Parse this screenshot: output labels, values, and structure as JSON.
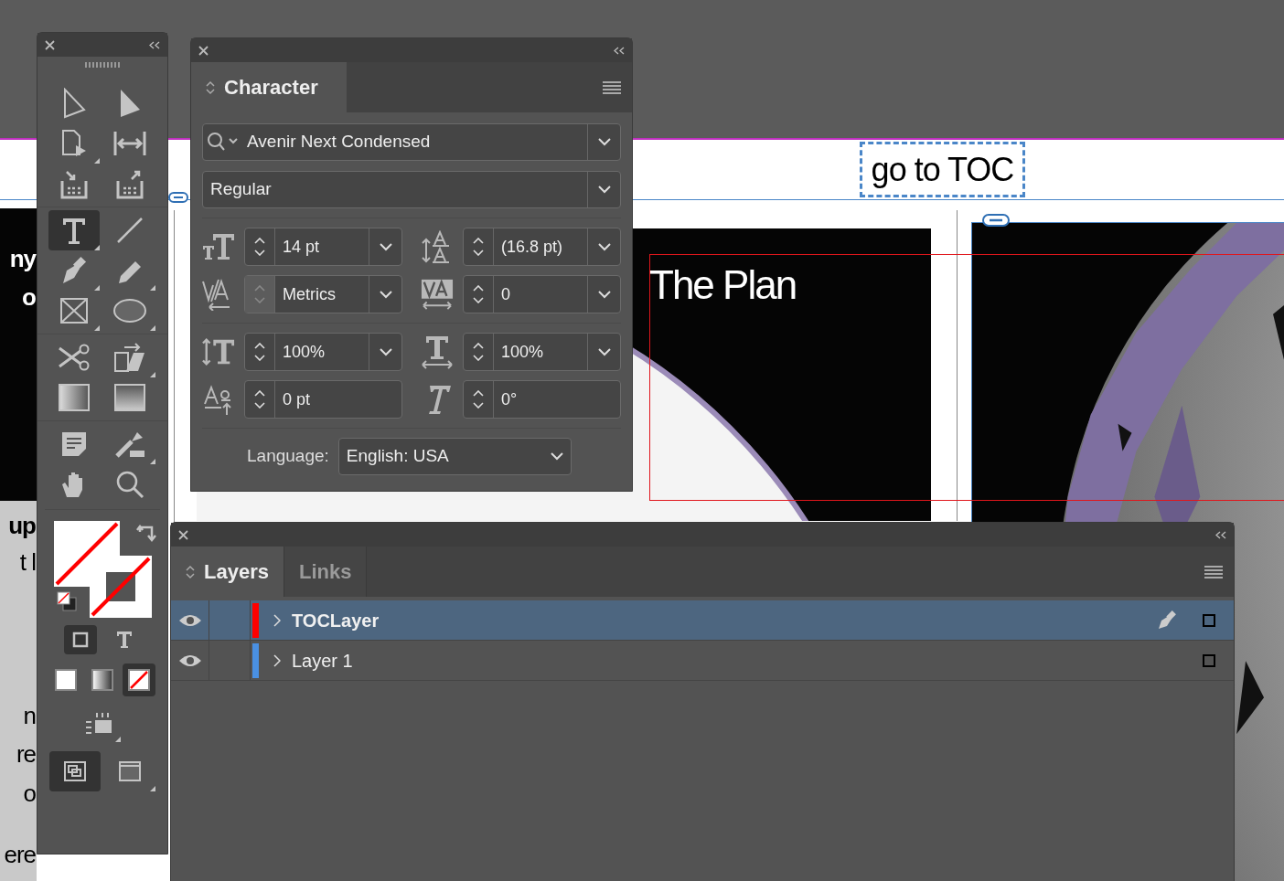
{
  "document": {
    "link_button": "go to TOC",
    "heading": "The Plan",
    "edge_texts": [
      {
        "text": "ny",
        "kind": "on_dark"
      },
      {
        "text": "o",
        "kind": "on_dark"
      },
      {
        "text": "up",
        "kind": "bold"
      },
      {
        "text": "t l",
        "kind": "plain"
      },
      {
        "text": "n",
        "kind": "plain"
      },
      {
        "text": "re",
        "kind": "plain"
      },
      {
        "text": "o",
        "kind": "plain"
      },
      {
        "text": "ere",
        "kind": "plain"
      }
    ]
  },
  "tools": {
    "groups": [
      [
        {
          "kind": "direct-select",
          "selected": false
        },
        {
          "kind": "select",
          "selected": false
        },
        {
          "kind": "page",
          "selected": false
        },
        {
          "kind": "gap",
          "selected": false
        },
        {
          "kind": "collector",
          "selected": false
        },
        {
          "kind": "placer",
          "selected": false
        }
      ],
      [
        {
          "kind": "type",
          "selected": true
        },
        {
          "kind": "line",
          "selected": false
        },
        {
          "kind": "pen",
          "selected": false
        },
        {
          "kind": "pencil",
          "selected": false
        },
        {
          "kind": "rect-frame",
          "selected": false
        },
        {
          "kind": "ellipse",
          "selected": false
        }
      ],
      [
        {
          "kind": "scissors",
          "selected": false
        },
        {
          "kind": "transform",
          "selected": false
        },
        {
          "kind": "gradient",
          "selected": false
        },
        {
          "kind": "feather",
          "selected": false
        }
      ],
      [
        {
          "kind": "note",
          "selected": false
        },
        {
          "kind": "eyedropper",
          "selected": false
        },
        {
          "kind": "hand",
          "selected": false
        },
        {
          "kind": "zoom",
          "selected": false
        }
      ]
    ],
    "format_targets": [
      {
        "kind": "container",
        "selected": true
      },
      {
        "kind": "text",
        "selected": false
      }
    ],
    "apply_buttons": [
      {
        "kind": "color",
        "selected": false
      },
      {
        "kind": "gradient",
        "selected": false
      },
      {
        "kind": "none",
        "selected": true
      }
    ],
    "view_modes": [
      {
        "kind": "normal",
        "selected": true
      },
      {
        "kind": "screen",
        "selected": false
      }
    ]
  },
  "character_panel": {
    "tab": "Character",
    "font": "Avenir Next Condensed",
    "style": "Regular",
    "rows": [
      [
        {
          "kind": "size",
          "value": "14 pt",
          "disabled": false,
          "dropdown": true
        },
        {
          "kind": "leading",
          "value": "(16.8 pt)",
          "disabled": false,
          "dropdown": true
        }
      ],
      [
        {
          "kind": "kerning",
          "value": "Metrics",
          "disabled": true,
          "dropdown": true
        },
        {
          "kind": "tracking",
          "value": "0",
          "disabled": false,
          "dropdown": true
        }
      ],
      [
        {
          "kind": "vscale",
          "value": "100%",
          "disabled": false,
          "dropdown": true
        },
        {
          "kind": "hscale",
          "value": "100%",
          "disabled": false,
          "dropdown": true
        }
      ],
      [
        {
          "kind": "baseline",
          "value": "0 pt",
          "disabled": false,
          "dropdown": false
        },
        {
          "kind": "skew",
          "value": "0°",
          "disabled": false,
          "dropdown": false
        }
      ]
    ],
    "language_label": "Language:",
    "language": "English: USA"
  },
  "layers_panel": {
    "tabs": [
      {
        "label": "Layers",
        "selected": true
      },
      {
        "label": "Links",
        "selected": false
      }
    ],
    "layers": [
      {
        "name": "TOCLayer",
        "selected": true,
        "visible": true,
        "current": true,
        "color": "#ff0000"
      },
      {
        "name": "Layer 1",
        "selected": false,
        "visible": true,
        "current": false,
        "color": "#4a90e2"
      }
    ]
  }
}
